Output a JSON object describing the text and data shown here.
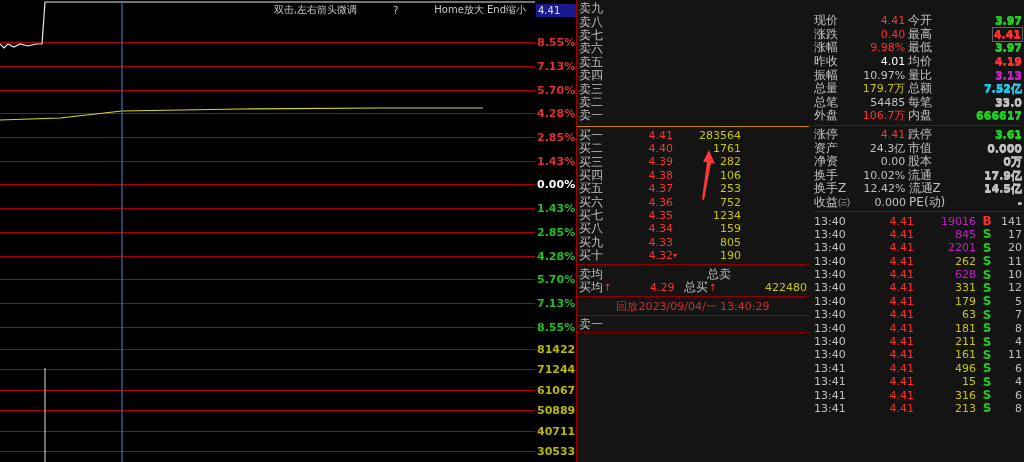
{
  "chart": {
    "hint": "双击,左右箭头微调",
    "help": "?",
    "zoom_hint": "Home放大 End缩小",
    "price_tag": "4.41",
    "axis_labels": [
      {
        "text": "8.55%",
        "color": "#e03030"
      },
      {
        "text": "7.13%",
        "color": "#e03030"
      },
      {
        "text": "5.70%",
        "color": "#e03030"
      },
      {
        "text": "4.28%",
        "color": "#e03030"
      },
      {
        "text": "2.85%",
        "color": "#e03030"
      },
      {
        "text": "1.43%",
        "color": "#e03030"
      },
      {
        "text": "0.00%",
        "color": "#ffffff"
      },
      {
        "text": "1.43%",
        "color": "#20c020"
      },
      {
        "text": "2.85%",
        "color": "#20c020"
      },
      {
        "text": "4.28%",
        "color": "#20c020"
      },
      {
        "text": "5.70%",
        "color": "#20c020"
      },
      {
        "text": "7.13%",
        "color": "#20c020"
      },
      {
        "text": "8.55%",
        "color": "#20c020"
      }
    ],
    "volume_labels": [
      "81422",
      "71244",
      "61067",
      "50889",
      "40711",
      "30533"
    ]
  },
  "order_book": {
    "asks": [
      "卖九",
      "卖八",
      "卖七",
      "卖六",
      "卖五",
      "卖四",
      "卖三",
      "卖二",
      "卖一"
    ],
    "bids": [
      {
        "label": "买一",
        "price": "4.41",
        "volume": "283564"
      },
      {
        "label": "买二",
        "price": "4.40",
        "volume": "1761"
      },
      {
        "label": "买三",
        "price": "4.39",
        "volume": "282"
      },
      {
        "label": "买四",
        "price": "4.38",
        "volume": "106"
      },
      {
        "label": "买五",
        "price": "4.37",
        "volume": "253"
      },
      {
        "label": "买六",
        "price": "4.36",
        "volume": "752"
      },
      {
        "label": "买七",
        "price": "4.35",
        "volume": "1234"
      },
      {
        "label": "买八",
        "price": "4.34",
        "volume": "159"
      },
      {
        "label": "买九",
        "price": "4.33",
        "volume": "805"
      },
      {
        "label": "买十",
        "price": "4.32",
        "volume": "190",
        "mark": "▾"
      }
    ],
    "ask_avg_label": "卖均",
    "total_ask_label": "总卖",
    "bid_avg_label": "买均",
    "bid_avg_mark": "↑",
    "bid_avg": "4.29",
    "total_bid_label": "总买",
    "total_bid_mark": "↑",
    "total_bid": "422480",
    "replay": "回放2023/09/04/一 13:40:29",
    "detail_label": "卖一"
  },
  "quote": [
    {
      "left": {
        "label": "现价",
        "value": "4.41",
        "color": "#ff3030"
      },
      "right": {
        "label": "今开",
        "value": "3.97",
        "color": "#20d020",
        "boxed": false
      }
    },
    {
      "left": {
        "label": "涨跌",
        "value": "0.40",
        "color": "#ff3030"
      },
      "right": {
        "label": "最高",
        "value": "4.41",
        "color": "#ff3030",
        "boxed": true
      }
    },
    {
      "left": {
        "label": "涨幅",
        "value": "9.98%",
        "color": "#ff3030"
      },
      "right": {
        "label": "最低",
        "value": "3.97",
        "color": "#20d020",
        "boxed": false
      }
    },
    {
      "left": {
        "label": "昨收",
        "value": "4.01",
        "color": "#ffffff"
      },
      "right": {
        "label": "均价",
        "value": "4.19",
        "color": "#ff3030",
        "boxed": false
      }
    },
    {
      "left": {
        "label": "振幅",
        "value": "10.97%",
        "color": "#c0c0c0"
      },
      "right": {
        "label": "量比",
        "value": "3.13",
        "color": "#c020c0",
        "boxed": false
      }
    },
    {
      "left": {
        "label": "总量",
        "value": "179.7万",
        "color": "#c8c800"
      },
      "right": {
        "label": "总额",
        "value": "7.52亿",
        "color": "#20c8e8",
        "boxed": false
      }
    },
    {
      "left": {
        "label": "总笔",
        "value": "54485",
        "color": "#c0c0c0"
      },
      "right": {
        "label": "每笔",
        "value": "33.0",
        "color": "#c0c0c0",
        "boxed": false
      }
    },
    {
      "left": {
        "label": "外盘",
        "value": "106.7万",
        "color": "#ff3030"
      },
      "right": {
        "label": "内盘",
        "value": "666617",
        "color": "#20d020",
        "boxed": false
      }
    }
  ],
  "stats": [
    {
      "left": {
        "label": "涨停",
        "value": "4.41",
        "color": "#ff3030"
      },
      "right": {
        "label": "跌停",
        "value": "3.61",
        "color": "#20d020"
      }
    },
    {
      "left": {
        "label": "资产",
        "value": "24.3亿",
        "color": "#c0c0c0"
      },
      "right": {
        "label": "市值",
        "value": "0.000",
        "color": "#c0c0c0"
      }
    },
    {
      "left": {
        "label": "净资",
        "value": "0.00",
        "color": "#c0c0c0"
      },
      "right": {
        "label": "股本",
        "value": "0万",
        "color": "#c0c0c0"
      }
    },
    {
      "left": {
        "label": "换手",
        "value": "10.02%",
        "color": "#c0c0c0"
      },
      "right": {
        "label": "流通",
        "value": "17.9亿",
        "color": "#c0c0c0"
      }
    },
    {
      "left": {
        "label": "换手Z",
        "value": "12.42%",
        "color": "#c0c0c0"
      },
      "right": {
        "label": "流通Z",
        "value": "14.5亿",
        "color": "#c0c0c0"
      }
    },
    {
      "left": {
        "label": "收益㈢",
        "value": "0.000",
        "color": "#c0c0c0"
      },
      "right": {
        "label": "PE(动)",
        "value": "-",
        "color": "#c0c0c0"
      }
    }
  ],
  "ticks": [
    {
      "time": "13:40",
      "price": "4.41",
      "volume": {
        "text": "19016",
        "color": "#c020c0"
      },
      "side": {
        "text": "B",
        "color": "#ff3030"
      },
      "count": "141"
    },
    {
      "time": "13:40",
      "price": "4.41",
      "volume": {
        "text": "845",
        "color": "#c020c0"
      },
      "side": {
        "text": "S",
        "color": "#20d020"
      },
      "count": "17"
    },
    {
      "time": "13:40",
      "price": "4.41",
      "volume": {
        "text": "2201",
        "color": "#c020c0"
      },
      "side": {
        "text": "S",
        "color": "#20d020"
      },
      "count": "20"
    },
    {
      "time": "13:40",
      "price": "4.41",
      "volume": {
        "text": "262",
        "color": "#c8c800"
      },
      "side": {
        "text": "S",
        "color": "#20d020"
      },
      "count": "11"
    },
    {
      "time": "13:40",
      "price": "4.41",
      "volume": {
        "text": "628",
        "color": "#c020c0"
      },
      "side": {
        "text": "S",
        "color": "#20d020"
      },
      "count": "10"
    },
    {
      "time": "13:40",
      "price": "4.41",
      "volume": {
        "text": "331",
        "color": "#c8c800"
      },
      "side": {
        "text": "S",
        "color": "#20d020"
      },
      "count": "12"
    },
    {
      "time": "13:40",
      "price": "4.41",
      "volume": {
        "text": "179",
        "color": "#c8c800"
      },
      "side": {
        "text": "S",
        "color": "#20d020"
      },
      "count": "5"
    },
    {
      "time": "13:40",
      "price": "4.41",
      "volume": {
        "text": "63",
        "color": "#c8c800"
      },
      "side": {
        "text": "S",
        "color": "#20d020"
      },
      "count": "7"
    },
    {
      "time": "13:40",
      "price": "4.41",
      "volume": {
        "text": "181",
        "color": "#c8c800"
      },
      "side": {
        "text": "S",
        "color": "#20d020"
      },
      "count": "8"
    },
    {
      "time": "13:40",
      "price": "4.41",
      "volume": {
        "text": "211",
        "color": "#c8c800"
      },
      "side": {
        "text": "S",
        "color": "#20d020"
      },
      "count": "4"
    },
    {
      "time": "13:40",
      "price": "4.41",
      "volume": {
        "text": "161",
        "color": "#c8c800"
      },
      "side": {
        "text": "S",
        "color": "#20d020"
      },
      "count": "11"
    },
    {
      "time": "13:41",
      "price": "4.41",
      "volume": {
        "text": "496",
        "color": "#c8c800"
      },
      "side": {
        "text": "S",
        "color": "#20d020"
      },
      "count": "6"
    },
    {
      "time": "13:41",
      "price": "4.41",
      "volume": {
        "text": "15",
        "color": "#c8c800"
      },
      "side": {
        "text": "S",
        "color": "#20d020"
      },
      "count": "4"
    },
    {
      "time": "13:41",
      "price": "4.41",
      "volume": {
        "text": "316",
        "color": "#c8c800"
      },
      "side": {
        "text": "S",
        "color": "#20d020"
      },
      "count": "6"
    },
    {
      "time": "13:41",
      "price": "4.41",
      "volume": {
        "text": "213",
        "color": "#c8c800"
      },
      "side": {
        "text": "S",
        "color": "#20d020"
      },
      "count": "8"
    }
  ]
}
